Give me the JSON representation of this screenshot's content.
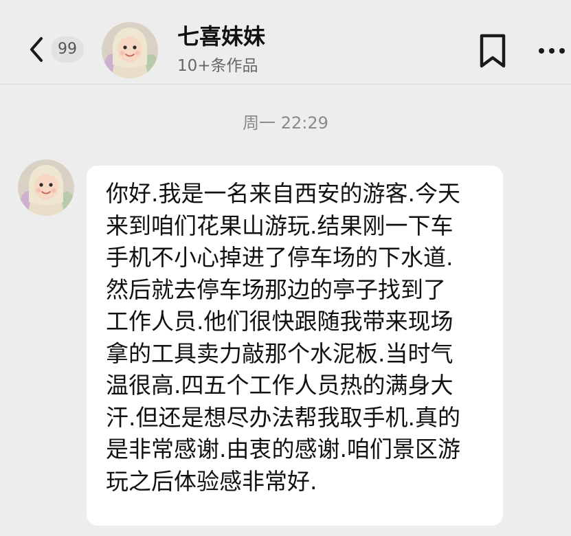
{
  "header": {
    "back_icon": "chevron-left-icon",
    "unread_count": "99",
    "contact_name": "七喜妹妹",
    "contact_subtitle": "10+条作品",
    "bookmark_icon": "bookmark-icon",
    "more_icon": "more-dots-icon"
  },
  "chat": {
    "timestamp": "周一 22:29",
    "message": {
      "lines": [
        "你好.我是一名来自西安的游客.今天",
        "来到咱们花果山游玩.结果刚一下车",
        "手机不小心掉进了停车场的下水道.",
        "然后就去停车场那边的亭子找到了",
        "工作人员.他们很快跟随我带来现场",
        "拿的工具卖力敲那个水泥板.当时气",
        "温很高.四五个工作人员热的满身大",
        "汗.但还是想尽办法帮我取手机.真的",
        "是非常感谢.由衷的感谢.咱们景区游",
        "玩之后体验感非常好."
      ]
    }
  },
  "colors": {
    "background": "#ededed",
    "bubble": "#ffffff",
    "text": "#111111",
    "muted": "#8a8a8a"
  }
}
